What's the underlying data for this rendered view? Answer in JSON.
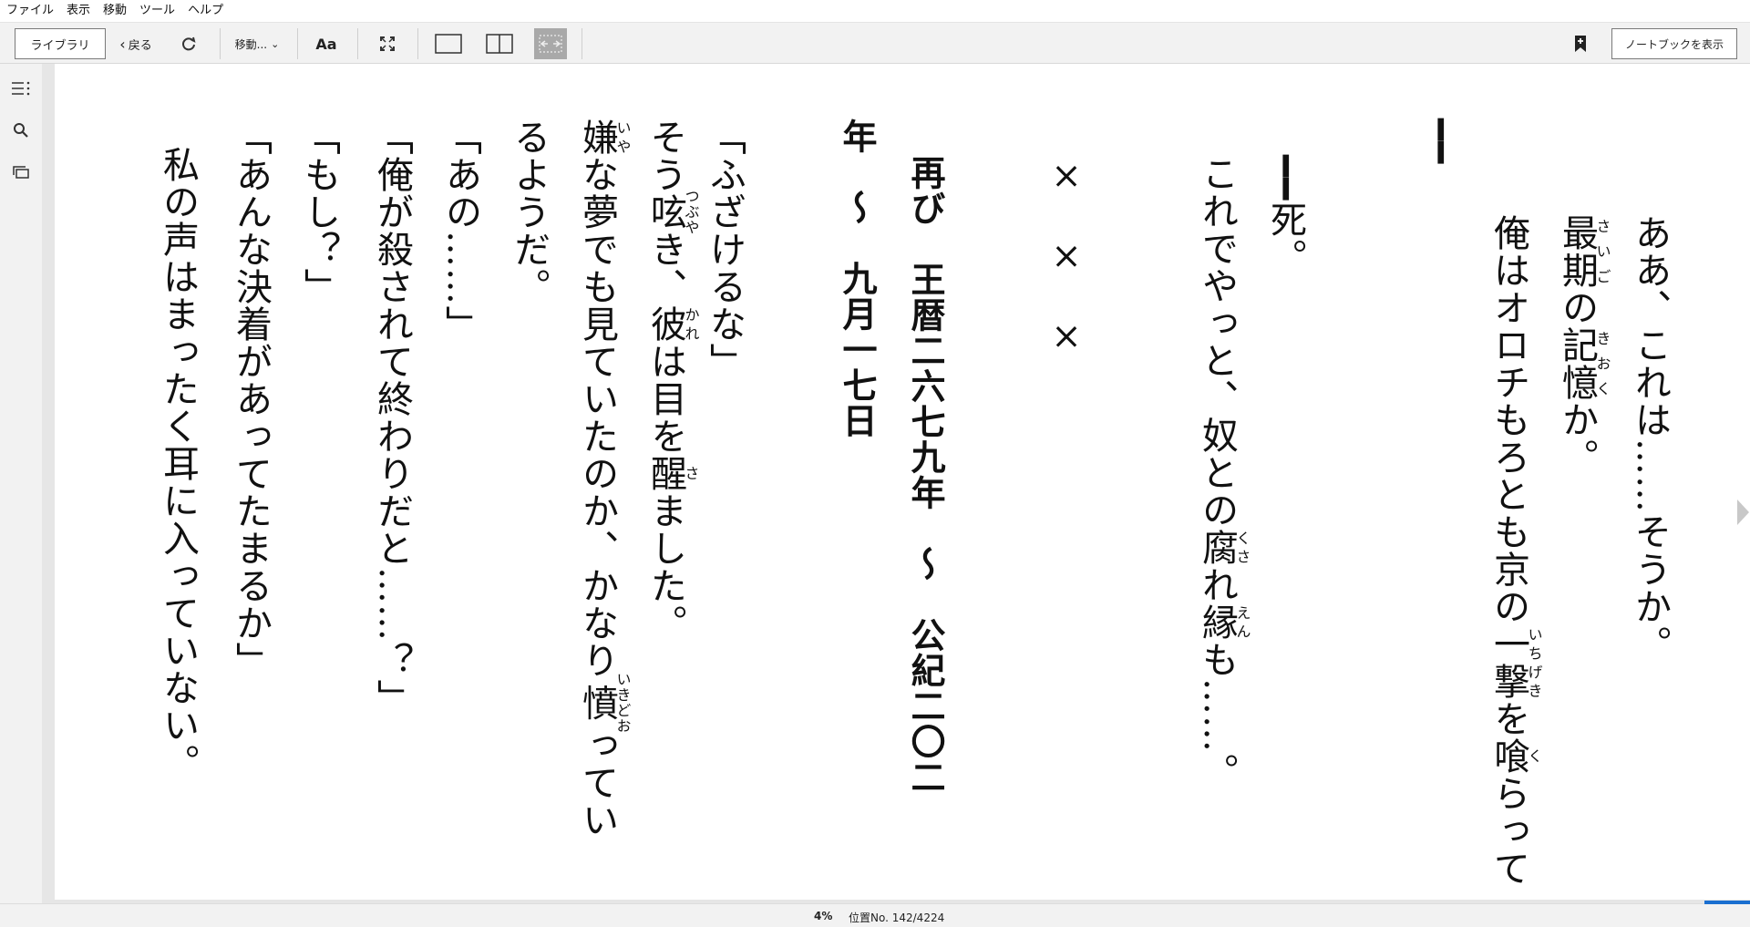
{
  "menu": [
    "ファイル",
    "表示",
    "移動",
    "ツール",
    "ヘルプ"
  ],
  "toolbar": {
    "library": "ライブラリ",
    "back": "戻る",
    "goto": "移動...",
    "font": "Aa",
    "notebook": "ノートブックを表示"
  },
  "reader": {
    "columns": [
      {
        "seg": [
          {
            "t": "ああ、これは……そうか。"
          }
        ]
      },
      {
        "seg": [
          {
            "b": "最期",
            "r": "さいご"
          },
          {
            "t": "の"
          },
          {
            "b": "記憶",
            "r": "きおく"
          },
          {
            "t": "か。"
          }
        ]
      },
      {
        "seg": [
          {
            "t": "俺はオロチもろとも京の"
          },
          {
            "b": "一撃",
            "r": "いちげき"
          },
          {
            "t": "を"
          },
          {
            "b": "喰",
            "r": "く"
          },
          {
            "t": "らって"
          }
        ]
      },
      {
        "seg": [
          {
            "t": "━━"
          }
        ]
      },
      {
        "seg": [
          {
            "t": ""
          }
        ]
      },
      {
        "seg": [
          {
            "t": "━━死。"
          }
        ]
      },
      {
        "seg": [
          {
            "t": "これでやっと、奴との"
          },
          {
            "b": "腐",
            "r": "くさ"
          },
          {
            "t": "れ"
          },
          {
            "b": "縁",
            "r": "えん"
          },
          {
            "t": "も……。"
          }
        ]
      },
      {
        "seg": [
          {
            "t": ""
          }
        ]
      },
      {
        "seg": [
          {
            "t": "×　×　×"
          }
        ]
      },
      {
        "seg": [
          {
            "t": ""
          }
        ]
      },
      {
        "seg": [
          {
            "t": "再び　王暦二六七九年　～　公紀二〇二"
          }
        ],
        "bold": true
      },
      {
        "seg": [
          {
            "t": "年　～　九月一七日"
          }
        ],
        "bold": true
      },
      {
        "seg": [
          {
            "t": ""
          }
        ]
      },
      {
        "seg": [
          {
            "t": "「ふざけるな」"
          }
        ]
      },
      {
        "seg": [
          {
            "t": "そう"
          },
          {
            "b": "呟",
            "r": "つぶや"
          },
          {
            "t": "き、"
          },
          {
            "b": "彼",
            "r": "かれ"
          },
          {
            "t": "は目を"
          },
          {
            "b": "醒",
            "r": "さ"
          },
          {
            "t": "ました。"
          }
        ]
      },
      {
        "seg": [
          {
            "b": "嫌",
            "r": "いや"
          },
          {
            "t": "な夢でも見ていたのか、かなり"
          },
          {
            "b": "憤",
            "r": "いきどお"
          },
          {
            "t": "ってい"
          }
        ]
      },
      {
        "seg": [
          {
            "t": "るようだ。"
          }
        ]
      },
      {
        "seg": [
          {
            "t": "「あの……」"
          }
        ]
      },
      {
        "seg": [
          {
            "t": "「俺が殺されて終わりだと……？」"
          }
        ]
      },
      {
        "seg": [
          {
            "t": "「もし？」"
          }
        ]
      },
      {
        "seg": [
          {
            "t": "「あんな決着があってたまるか」"
          }
        ]
      },
      {
        "seg": [
          {
            "t": "私の声はまったく耳に入っていない。"
          }
        ]
      }
    ]
  },
  "status": {
    "percent": "4%",
    "location": "位置No. 142/4224",
    "progress_fraction": 0.04
  },
  "colors": {
    "accent": "#1a6fd0",
    "chrome": "#f2f2f2"
  }
}
